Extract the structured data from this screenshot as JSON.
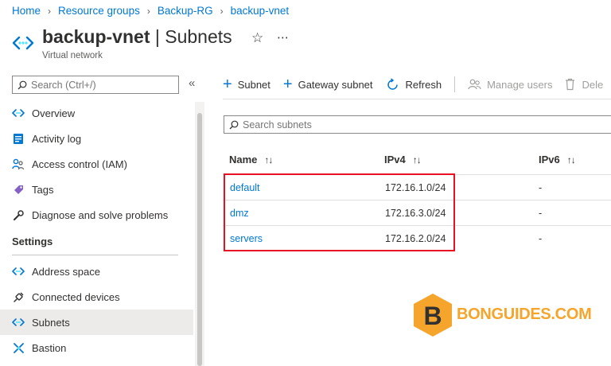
{
  "breadcrumb": [
    "Home",
    "Resource groups",
    "Backup-RG",
    "backup-vnet"
  ],
  "header": {
    "title_main": "backup-vnet",
    "title_section": "| Subnets",
    "subtitle": "Virtual network"
  },
  "sidebar": {
    "search_placeholder": "Search (Ctrl+/)",
    "items_top": [
      {
        "label": "Overview",
        "icon": "vnet-icon"
      },
      {
        "label": "Activity log",
        "icon": "activity-log-icon"
      },
      {
        "label": "Access control (IAM)",
        "icon": "iam-icon"
      },
      {
        "label": "Tags",
        "icon": "tag-icon"
      },
      {
        "label": "Diagnose and solve problems",
        "icon": "wrench-icon"
      }
    ],
    "section_settings": "Settings",
    "items_settings": [
      {
        "label": "Address space",
        "icon": "vnet-icon"
      },
      {
        "label": "Connected devices",
        "icon": "plug-icon"
      },
      {
        "label": "Subnets",
        "icon": "vnet-icon",
        "active": true
      },
      {
        "label": "Bastion",
        "icon": "bastion-icon"
      }
    ]
  },
  "toolbar": {
    "add_subnet": "Subnet",
    "gateway_subnet": "Gateway subnet",
    "refresh": "Refresh",
    "manage_users": "Manage users",
    "delete": "Dele"
  },
  "subnet_search": {
    "placeholder": "Search subnets"
  },
  "table": {
    "headers": [
      "Name",
      "IPv4",
      "IPv6"
    ],
    "sort_glyph": "↑↓",
    "rows": [
      {
        "name": "default",
        "ipv4": "172.16.1.0/24",
        "ipv6": "-"
      },
      {
        "name": "dmz",
        "ipv4": "172.16.3.0/24",
        "ipv6": "-"
      },
      {
        "name": "servers",
        "ipv4": "172.16.2.0/24",
        "ipv6": "-"
      }
    ]
  },
  "watermark": {
    "letter": "B",
    "text": "BONGUIDES.COM"
  },
  "colors": {
    "accent": "#0078d4",
    "highlight": "#e81123",
    "watermark": "#f5a52b"
  }
}
